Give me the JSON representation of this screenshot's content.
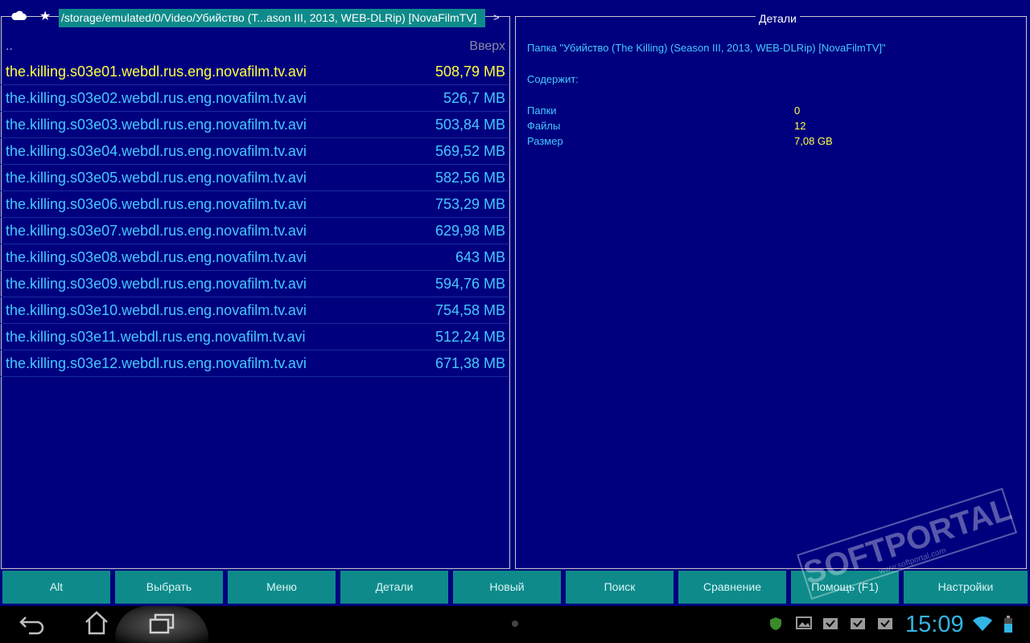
{
  "topbar": {
    "cloud_icon": "cloud-icon",
    "star_icon": "star-icon",
    "path": "/storage/emulated/0/Video/Убийство (T...ason III, 2013, WEB-DLRip) [NovaFilmTV]",
    "arrow": ">"
  },
  "file_panel": {
    "up_dots": "..",
    "up_label": "Вверх",
    "files": [
      {
        "name": "the.killing.s03e01.webdl.rus.eng.novafilm.tv.avi",
        "size": "508,79 MB",
        "selected": true
      },
      {
        "name": "the.killing.s03e02.webdl.rus.eng.novafilm.tv.avi",
        "size": "526,7 MB"
      },
      {
        "name": "the.killing.s03e03.webdl.rus.eng.novafilm.tv.avi",
        "size": "503,84 MB"
      },
      {
        "name": "the.killing.s03e04.webdl.rus.eng.novafilm.tv.avi",
        "size": "569,52 MB"
      },
      {
        "name": "the.killing.s03e05.webdl.rus.eng.novafilm.tv.avi",
        "size": "582,56 MB"
      },
      {
        "name": "the.killing.s03e06.webdl.rus.eng.novafilm.tv.avi",
        "size": "753,29 MB"
      },
      {
        "name": "the.killing.s03e07.webdl.rus.eng.novafilm.tv.avi",
        "size": "629,98 MB"
      },
      {
        "name": "the.killing.s03e08.webdl.rus.eng.novafilm.tv.avi",
        "size": "643 MB"
      },
      {
        "name": "the.killing.s03e09.webdl.rus.eng.novafilm.tv.avi",
        "size": "594,76 MB"
      },
      {
        "name": "the.killing.s03e10.webdl.rus.eng.novafilm.tv.avi",
        "size": "754,58 MB"
      },
      {
        "name": "the.killing.s03e11.webdl.rus.eng.novafilm.tv.avi",
        "size": "512,24 MB"
      },
      {
        "name": "the.killing.s03e12.webdl.rus.eng.novafilm.tv.avi",
        "size": "671,38 MB"
      }
    ]
  },
  "details": {
    "title": "Детали",
    "folder_line": "Папка \"Убийство (The Killing) (Season III, 2013, WEB-DLRip) [NovaFilmTV]\"",
    "contains_label": "Содержит:",
    "folders_label": "Папки",
    "folders_value": "0",
    "files_label": "Файлы",
    "files_value": "12",
    "size_label": "Размер",
    "size_value": "7,08 GB"
  },
  "buttons": [
    "Alt",
    "Выбрать",
    "Меню",
    "Детали",
    "Новый",
    "Поиск",
    "Сравнение",
    "Помощь (F1)",
    "Настройки"
  ],
  "navbar": {
    "back_icon": "back-icon",
    "home_icon": "home-icon",
    "recents_icon": "recents-icon",
    "clock": "15:09"
  },
  "watermark": {
    "main": "SOFTPORTAL",
    "sub": "www.softportal.com"
  },
  "colors": {
    "background": "#00007f",
    "file_text": "#45c8ff",
    "selected_text": "#ffff40",
    "button_bg": "#0f8a8a",
    "clock": "#33b5e5"
  }
}
